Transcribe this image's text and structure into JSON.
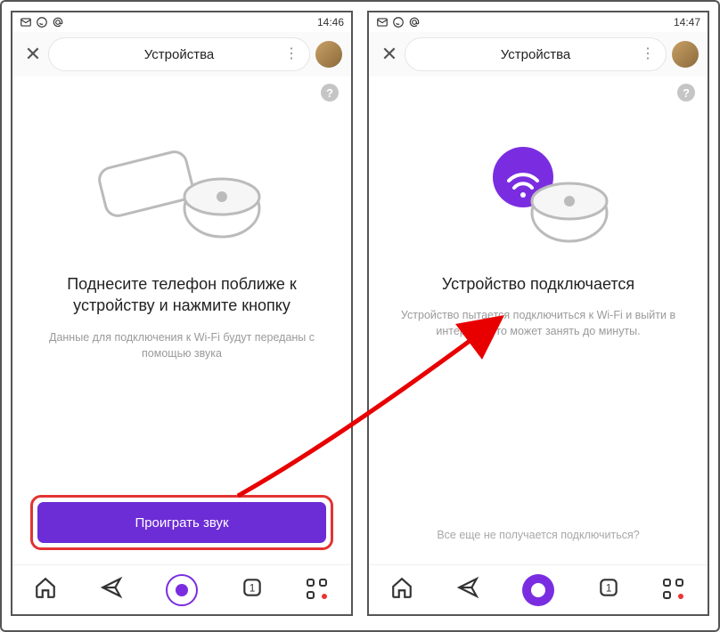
{
  "left": {
    "status_time": "14:46",
    "header_title": "Устройства",
    "heading": "Поднесите телефон поближе к устройству и нажмите кнопку",
    "subtext": "Данные для подключения к Wi-Fi будут переданы с помощью звука",
    "button_label": "Проиграть звук"
  },
  "right": {
    "status_time": "14:47",
    "header_title": "Устройства",
    "heading": "Устройство подключается",
    "subtext": "Устройство пытается подключиться к Wi-Fi и выйти в интернет. Это может занять до минуты.",
    "hint": "Все еще не получается подключиться?"
  },
  "icons": {
    "help": "?",
    "close": "✕",
    "dots": "⋮"
  }
}
